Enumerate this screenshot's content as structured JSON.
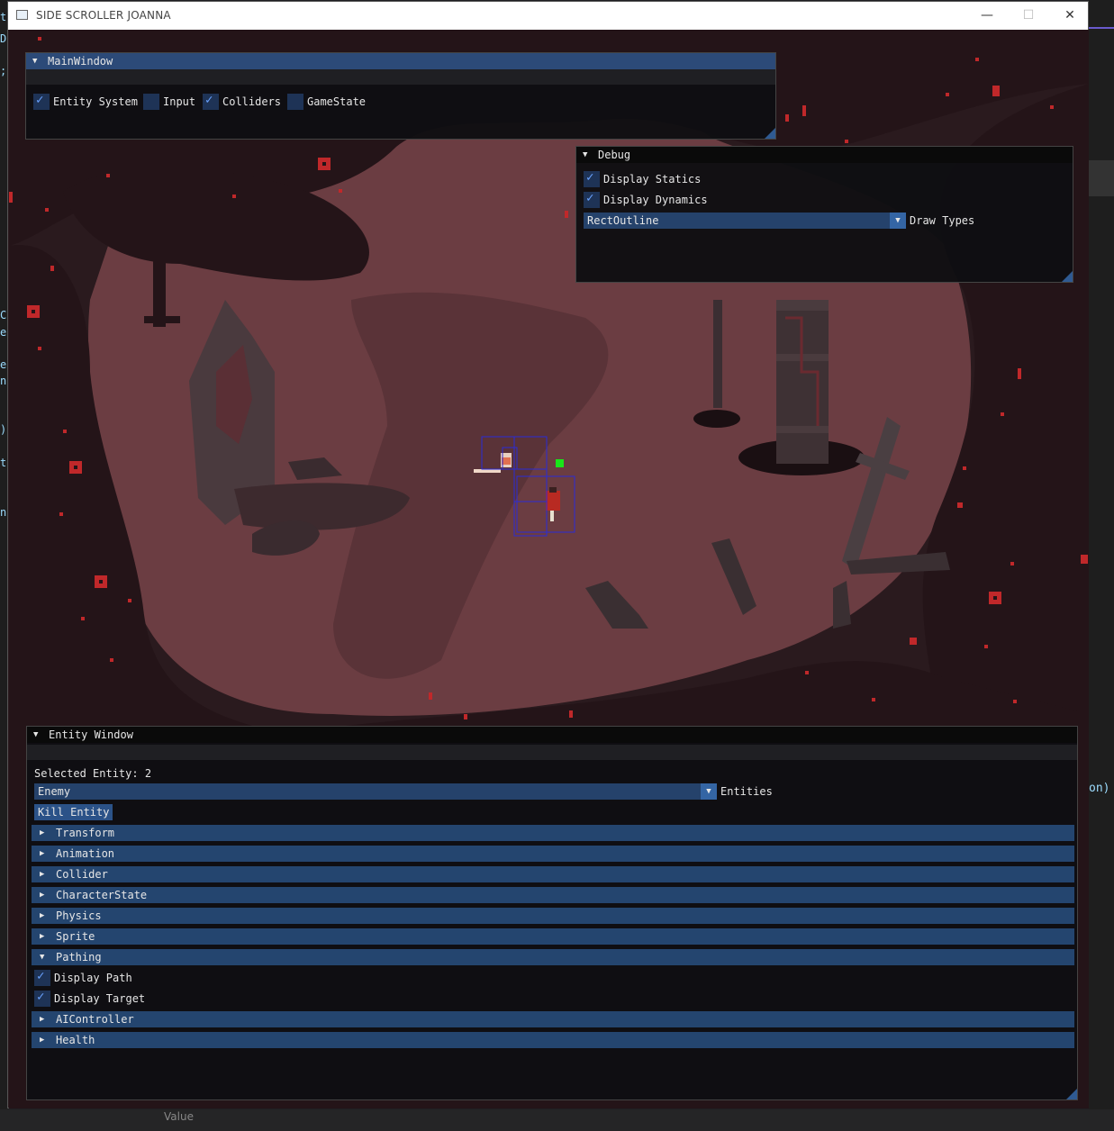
{
  "window": {
    "title": "SIDE SCROLLER JOANNA",
    "minimize": "—",
    "maximize": "☐",
    "close": "✕"
  },
  "ide": {
    "bottom_label": "Value",
    "right_fragment": "on)",
    "left_fragments": [
      "te",
      "Do",
      ";",
      "C",
      "e",
      "e",
      "n",
      ")",
      "t",
      "n"
    ]
  },
  "main_window": {
    "title": "MainWindow",
    "checkboxes": [
      {
        "label": "Entity System",
        "checked": true
      },
      {
        "label": "Input",
        "checked": false
      },
      {
        "label": "Colliders",
        "checked": true
      },
      {
        "label": "GameState",
        "checked": false
      }
    ]
  },
  "debug_window": {
    "title": "Debug",
    "checkboxes": [
      {
        "label": "Display Statics",
        "checked": true
      },
      {
        "label": "Display Dynamics",
        "checked": true
      }
    ],
    "combo_value": "RectOutline",
    "combo_label": "Draw Types"
  },
  "entity_window": {
    "title": "Entity Window",
    "selected_text": "Selected Entity: 2",
    "combo_value": "Enemy",
    "combo_label": "Entities",
    "kill_button": "Kill Entity",
    "headers": [
      {
        "label": "Transform",
        "open": false
      },
      {
        "label": "Animation",
        "open": false
      },
      {
        "label": "Collider",
        "open": false
      },
      {
        "label": "CharacterState",
        "open": false
      },
      {
        "label": "Physics",
        "open": false
      },
      {
        "label": "Sprite",
        "open": false
      },
      {
        "label": "Pathing",
        "open": true
      },
      {
        "label": "AIController",
        "open": false
      },
      {
        "label": "Health",
        "open": false
      }
    ],
    "pathing_checkboxes": [
      {
        "label": "Display Path",
        "checked": true
      },
      {
        "label": "Display Target",
        "checked": true
      }
    ]
  },
  "colors": {
    "header_active": "#2c4a78",
    "header_item": "#24456f",
    "check_mark": "#6aa2ff",
    "collider_outline": "#2b2bd6",
    "target_marker": "#19e619",
    "ground": "#6b3d42",
    "foliage": "#2a1a1e"
  },
  "icons": {
    "collapse_open": "triangle-down-icon",
    "collapse_closed": "triangle-right-icon",
    "check": "check-icon",
    "combo_arrow": "chevron-down-icon"
  }
}
